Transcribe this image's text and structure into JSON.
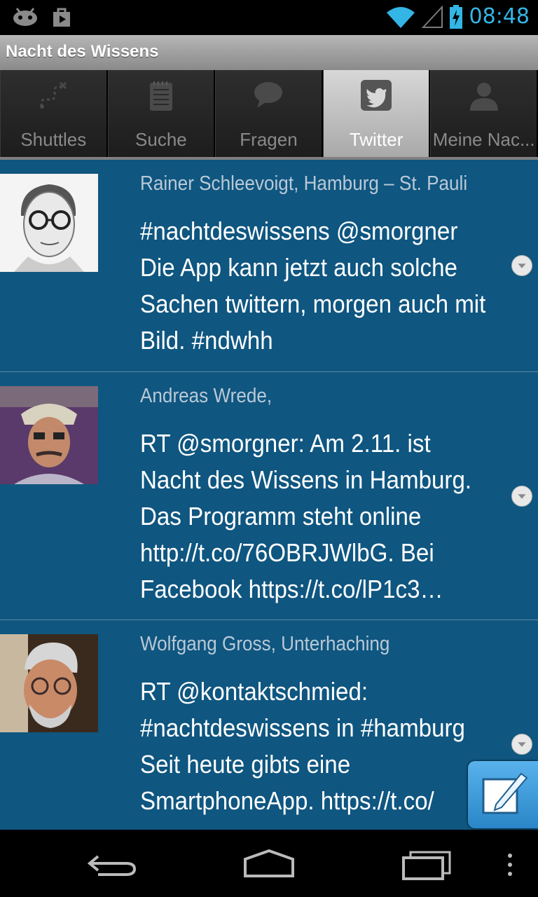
{
  "status_bar": {
    "time": "08:48"
  },
  "app": {
    "title": "Nacht des Wissens"
  },
  "tabs": [
    {
      "label": "Shuttles",
      "icon": "shuttle-route-icon",
      "active": false
    },
    {
      "label": "Suche",
      "icon": "notepad-icon",
      "active": false
    },
    {
      "label": "Fragen",
      "icon": "speech-bubble-icon",
      "active": false
    },
    {
      "label": "Twitter",
      "icon": "twitter-bird-icon",
      "active": true
    },
    {
      "label": "Meine Nac...",
      "icon": "person-icon",
      "active": false
    }
  ],
  "tweets": [
    {
      "author": "Rainer Schleevoigt, Hamburg   – St. Pauli",
      "text": "#nachtdeswissens @smorgner Die App kann jetzt auch solche Sachen twittern, morgen auch mit Bild. #ndwhh"
    },
    {
      "author": "Andreas Wrede,",
      "text": "RT @smorgner: Am 2.11. ist Nacht des Wissens in Hamburg. Das Programm steht online  http://t.co/76OBRJWlbG. Bei Facebook https://t.co/lP1c3…"
    },
    {
      "author": "Wolfgang Gross, Unterhaching",
      "text": "RT @kontaktschmied: #nachtdeswissens in #hamburg Seit heute gibts eine SmartphoneApp. https://t.co/"
    }
  ],
  "colors": {
    "feed_bg": "#0f5680",
    "clock": "#33b5e5",
    "author": "#b9c9d6"
  }
}
